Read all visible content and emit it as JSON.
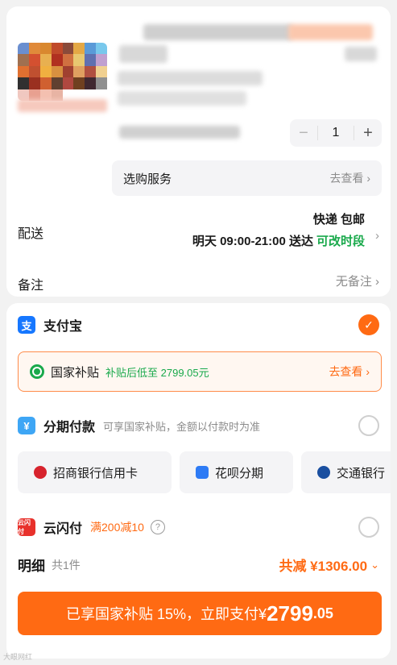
{
  "product": {
    "quantity": "1",
    "minus_label": "−",
    "plus_label": "+",
    "thumb_colors": [
      "#6a8fd0",
      "#e08a3a",
      "#d9882f",
      "#c04a2a",
      "#8a4a3a",
      "#e4a845",
      "#5a9ad8",
      "#79c8ec",
      "#a07050",
      "#d45030",
      "#e8b050",
      "#b03020",
      "#d07040",
      "#e8c870",
      "#6070b0",
      "#c0a0d0",
      "#e07030",
      "#c05030",
      "#f0b040",
      "#d89040",
      "#a04030",
      "#e0a060",
      "#b05040",
      "#f0d090",
      "#303030",
      "#9a3020",
      "#d06030",
      "#604030",
      "#b04840",
      "#704020",
      "#402830",
      "#909090",
      "#f0c8c0",
      "#e8a090",
      "#f4c0b0",
      "#e8b4a4",
      "#ffffff",
      "#ffffff",
      "#ffffff",
      "#ffffff"
    ]
  },
  "service": {
    "label": "选购服务",
    "link": "去查看 ›"
  },
  "delivery": {
    "label": "配送",
    "method": "快递 包邮",
    "time": "明天 09:00-21:00 送达",
    "editable": "可改时段",
    "chevron": "›"
  },
  "note": {
    "label": "备注",
    "value": "无备注 ›"
  },
  "payment": {
    "alipay": {
      "icon_glyph": "支",
      "name": "支付宝",
      "check": "✓"
    },
    "subsidy": {
      "title": "国家补贴",
      "desc": "补贴后低至 2799.05元",
      "link": "去查看 ›"
    },
    "installment": {
      "icon_glyph": "¥",
      "name": "分期付款",
      "desc": "可享国家补贴，金额以付款时为准"
    },
    "cards": [
      "招商银行信用卡",
      "花呗分期",
      "交通银行"
    ],
    "unionpay": {
      "icon_glyph": "云闪付",
      "name": "云闪付",
      "promo": "满200减10",
      "help": "?"
    }
  },
  "detail": {
    "label": "明细",
    "count": "共1件",
    "total": "共减 ¥1306.00",
    "chevron": "⌄"
  },
  "pay_button": {
    "prefix": "已享国家补贴 15%，立即支付¥",
    "integer": "2799",
    "decimal": ".05"
  },
  "watermark": "大眼网红",
  "colors": {
    "accent": "#ff6a13",
    "green": "#19a94b",
    "alipay_blue": "#1677ff"
  }
}
